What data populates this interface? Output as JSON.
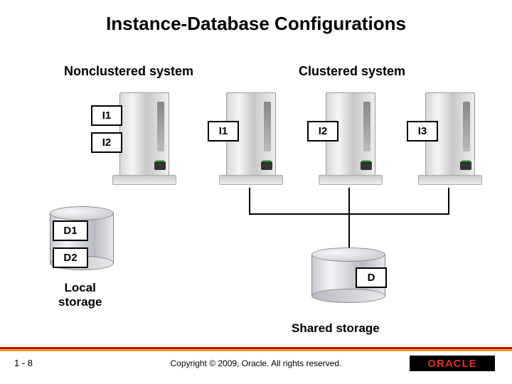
{
  "title": "Instance-Database Configurations",
  "left": {
    "heading": "Nonclustered system",
    "instances": [
      "I1",
      "I2"
    ],
    "databases": [
      "D1",
      "D2"
    ],
    "storage_label": "Local\nstorage"
  },
  "right": {
    "heading": "Clustered system",
    "instances": [
      "I1",
      "I2",
      "I3"
    ],
    "database": "D",
    "storage_label": "Shared storage"
  },
  "footer": {
    "page": "1 - 8",
    "copyright": "Copyright © 2009, Oracle. All rights reserved.",
    "logo_text": "ORACLE"
  }
}
